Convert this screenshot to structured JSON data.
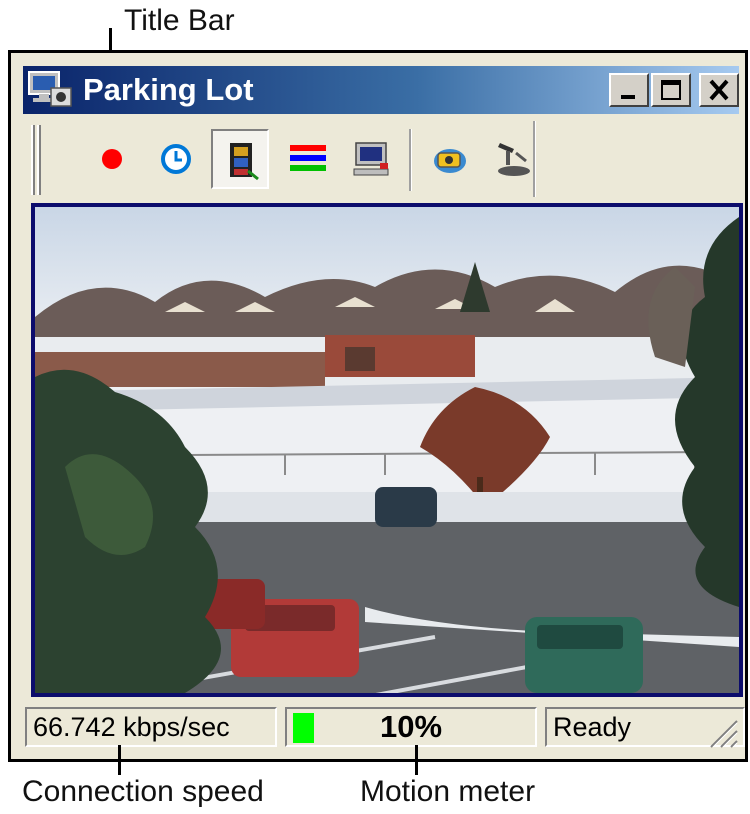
{
  "annotations": {
    "title_bar": "Title Bar",
    "connection_speed": "Connection speed",
    "motion_meter": "Motion meter"
  },
  "window": {
    "title": "Parking Lot",
    "app_icon": "camera-monitor-icon",
    "controls": [
      "minimize-icon",
      "maximize-icon",
      "close-icon"
    ]
  },
  "toolbar": {
    "buttons": [
      {
        "icon": "record-dot-icon",
        "color": "#ff0000"
      },
      {
        "icon": "clock-icon",
        "color": "#0078d7"
      },
      {
        "icon": "filmstrip-icon",
        "pressed": true
      },
      {
        "icon": "color-bars-icon",
        "colors": [
          "#ff0000",
          "#0000ff",
          "#00c000"
        ]
      },
      {
        "icon": "computer-monitor-icon"
      },
      {
        "icon": "camera-snapshot-icon"
      },
      {
        "icon": "pan-tilt-camera-icon"
      }
    ]
  },
  "video": {
    "description_icon": "live-camera-feed-image"
  },
  "status": {
    "speed": "66.742 kbps/sec",
    "motion_percent": "10%",
    "motion_level": 0.1,
    "motion_color": "#00ff00",
    "state": "Ready"
  }
}
